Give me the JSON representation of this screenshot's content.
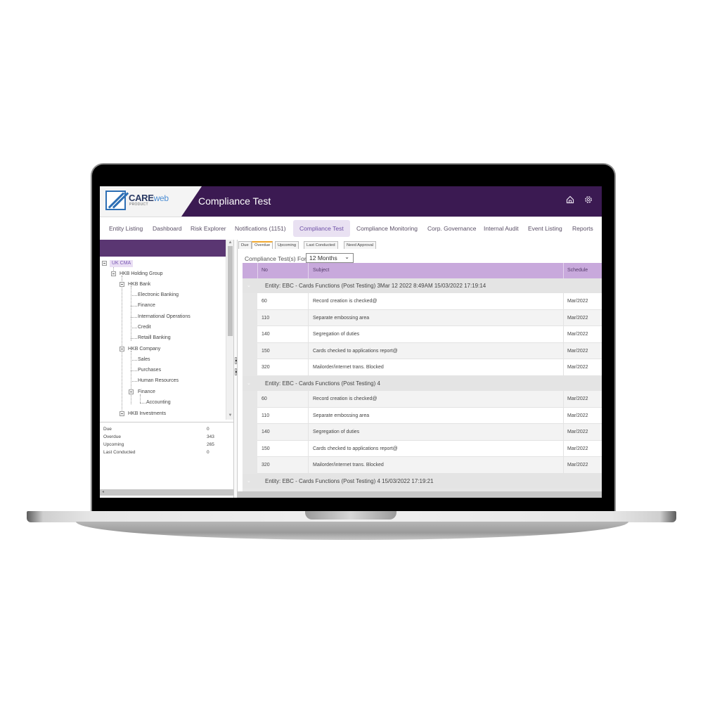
{
  "app": {
    "logo_brand": "CARE",
    "logo_suffix": "web",
    "logo_sub": "PRODUCT",
    "title": "Compliance Test",
    "header_icons": [
      "home-icon",
      "gear-icon"
    ]
  },
  "nav": {
    "items": [
      {
        "label": "Entity Listing"
      },
      {
        "label": "Dashboard"
      },
      {
        "label": "Risk Explorer"
      },
      {
        "label": "Notifications (1151)"
      },
      {
        "label": "Compliance Test",
        "active": true
      },
      {
        "label": "Compliance Monitoring"
      },
      {
        "label": "Corp. Governance"
      },
      {
        "label": "Internal Audit"
      },
      {
        "label": "Event Listing"
      },
      {
        "label": "Reports"
      }
    ]
  },
  "tree": {
    "nodes": [
      {
        "label": "UK CMA",
        "level": 0,
        "selected": true
      },
      {
        "label": "HKB Holding Group",
        "level": 1
      },
      {
        "label": "HKB Bank",
        "level": 2
      },
      {
        "label": "Electronic Banking",
        "level": 3
      },
      {
        "label": "Finance",
        "level": 3
      },
      {
        "label": "International Operations",
        "level": 3
      },
      {
        "label": "Credit",
        "level": 3
      },
      {
        "label": "Retaill Banking",
        "level": 3
      },
      {
        "label": "HKB Company",
        "level": 2
      },
      {
        "label": "Sales",
        "level": 3
      },
      {
        "label": "Purchases",
        "level": 3
      },
      {
        "label": "Human Resources",
        "level": 3
      },
      {
        "label": "Finance",
        "level": 3
      },
      {
        "label": "Accounting",
        "level": 4
      },
      {
        "label": "HKB Investments",
        "level": 2
      }
    ]
  },
  "stats": [
    {
      "label": "Due",
      "value": "0"
    },
    {
      "label": "Overdue",
      "value": "343"
    },
    {
      "label": "Upcoming",
      "value": "265"
    },
    {
      "label": "Last Conducted",
      "value": "0"
    }
  ],
  "subtabs": [
    {
      "label": "Due"
    },
    {
      "label": "Overdue",
      "active": true
    },
    {
      "label": "Upcoming"
    },
    {
      "label": "Last Conducted"
    },
    {
      "label": "Need Approval"
    }
  ],
  "filter": {
    "label": "Compliance Test(s) For",
    "selected": "12 Months"
  },
  "grid": {
    "columns": [
      "No",
      "Subject",
      "Schedule"
    ],
    "groups": [
      {
        "title": "Entity: EBC - Cards Functions (Post Testing) 3Mar 12 2022 8:49AM 15/03/2022 17:19:14",
        "rows": [
          {
            "no": "60",
            "subject": "Record creation is checked@",
            "schedule": "Mar/2022"
          },
          {
            "no": "110",
            "subject": "Separate embossing area",
            "schedule": "Mar/2022"
          },
          {
            "no": "140",
            "subject": "Segregation of duties",
            "schedule": "Mar/2022"
          },
          {
            "no": "150",
            "subject": "Cards checked to applications report@",
            "schedule": "Mar/2022"
          },
          {
            "no": "320",
            "subject": "Mailorder/internet trans. Blocked",
            "schedule": "Mar/2022"
          }
        ]
      },
      {
        "title": "Entity: EBC - Cards Functions (Post Testing) 4",
        "rows": [
          {
            "no": "60",
            "subject": "Record creation is checked@",
            "schedule": "Mar/2022"
          },
          {
            "no": "110",
            "subject": "Separate embossing area",
            "schedule": "Mar/2022"
          },
          {
            "no": "140",
            "subject": "Segregation of duties",
            "schedule": "Mar/2022"
          },
          {
            "no": "150",
            "subject": "Cards checked to applications report@",
            "schedule": "Mar/2022"
          },
          {
            "no": "320",
            "subject": "Mailorder/internet trans. Blocked",
            "schedule": "Mar/2022"
          }
        ]
      },
      {
        "title": "Entity: EBC - Cards Functions (Post Testing) 4 15/03/2022 17:19:21",
        "rows": []
      }
    ]
  },
  "colors": {
    "header_bg": "#3b1a52",
    "accent": "#c8a9dc",
    "active_tab_bg": "#e9e1f2",
    "overdue_tab_accent": "#f0a830"
  }
}
